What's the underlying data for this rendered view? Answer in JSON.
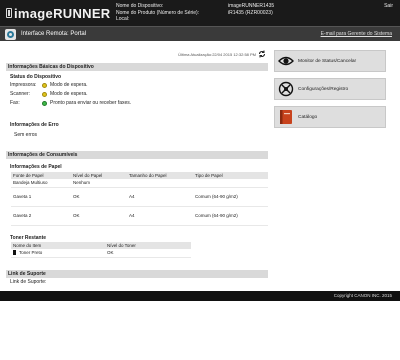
{
  "header": {
    "brand": "imageRUNNER",
    "device_name_label": "Nome do Dispositivo:",
    "device_name_value": "imageRUNNER1435",
    "product_label": "Nome do Produto (Número de Série):",
    "product_value": "iR1435 (RZR00023)",
    "location_label": "Local:",
    "location_value": "",
    "logout_label": "Sair"
  },
  "portal": {
    "title": "Interface Remota: Portal",
    "admin_link": "E-mail para Gerente do Sistema"
  },
  "main": {
    "last_update": "Última Atualização:22/04 2015 12:32:58 PM",
    "basic_info_title": "Informações Básicas do Dispositivo",
    "device_status_title": "Status do Dispositivo",
    "status": [
      {
        "label": "Impressora:",
        "value": "Modo de espera.",
        "color": "#e0c41a"
      },
      {
        "label": "Scanner:",
        "value": "Modo de espera.",
        "color": "#e0c41a"
      },
      {
        "label": "Fax:",
        "value": "Pronto para enviar ou receber faxes.",
        "color": "#3fb94a"
      }
    ],
    "error_title": "Informações de Erro",
    "error_value": "Sem erros",
    "consumables_title": "Informações de Consumíveis",
    "paper_title": "Informações de Papel",
    "paper_headers": [
      "Fonte de Papel",
      "Nível do Papel",
      "Tamanho do Papel",
      "Tipo de Papel"
    ],
    "paper_rows": [
      [
        "Bandeja Multiuso",
        "Nenhum",
        "",
        ""
      ],
      [
        "Gaveta 1",
        "OK",
        "A4",
        "Comum (64-90 g/m2)"
      ],
      [
        "Gaveta 2",
        "OK",
        "A4",
        "Comum (64-90 g/m2)"
      ]
    ],
    "toner_title": "Toner Restante",
    "toner_headers": [
      "Nome do Item",
      "Nível do Toner"
    ],
    "toner_rows": [
      [
        "Toner Preto",
        "OK"
      ]
    ],
    "support_title": "Link de Suporte",
    "support_value": "Link de Suporte:"
  },
  "sidebar": {
    "items": [
      {
        "label": "Monitor de Status/Cancelar",
        "icon": "eye-icon"
      },
      {
        "label": "Configurações/Registro",
        "icon": "settings-icon"
      },
      {
        "label": "Catálogo",
        "icon": "book-icon"
      }
    ]
  },
  "footer": {
    "copyright": "Copyright CANON INC. 2015"
  }
}
